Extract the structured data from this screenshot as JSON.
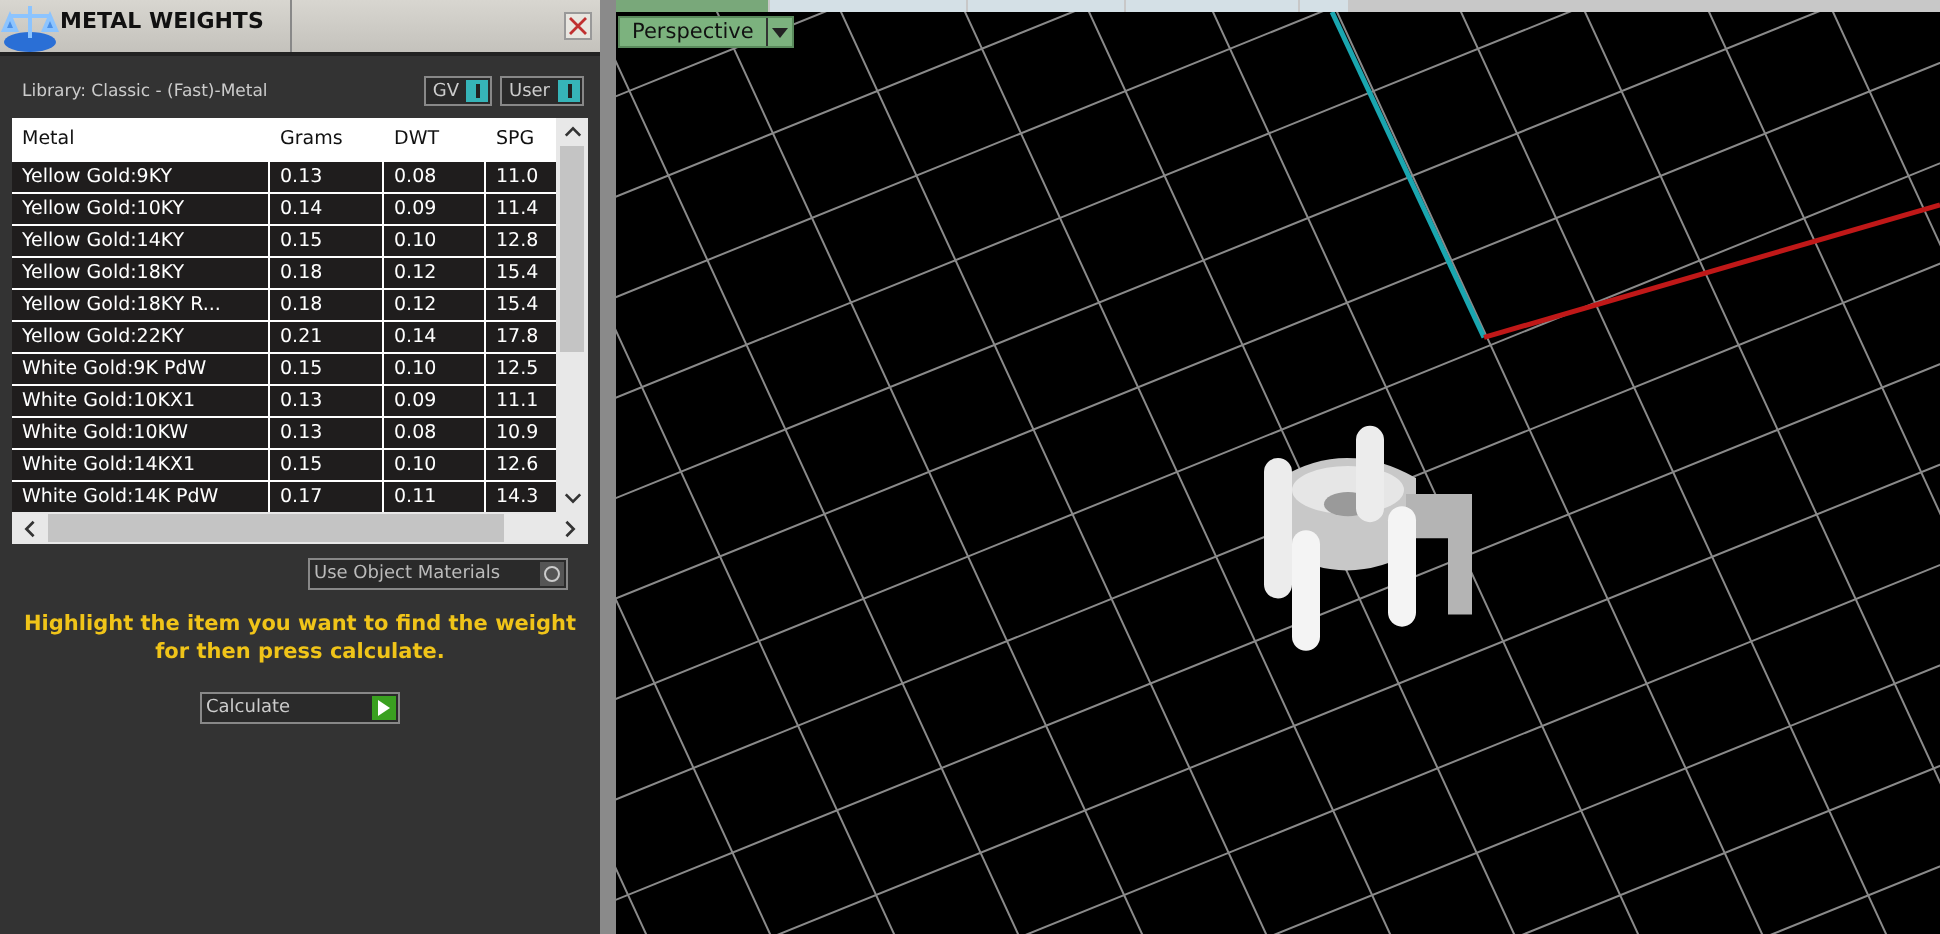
{
  "panel": {
    "title": "METAL WEIGHTS",
    "library": "Library: Classic - (Fast)-Metal",
    "toggles": [
      {
        "label": "GV",
        "on": true
      },
      {
        "label": "User",
        "on": true
      }
    ],
    "table": {
      "columns": [
        "Metal",
        "Grams",
        "DWT",
        "SPG"
      ],
      "rows": [
        [
          "Yellow Gold:9KY",
          "0.13",
          "0.08",
          "11.0"
        ],
        [
          "Yellow Gold:10KY",
          "0.14",
          "0.09",
          "11.4"
        ],
        [
          "Yellow Gold:14KY",
          "0.15",
          "0.10",
          "12.8"
        ],
        [
          "Yellow Gold:18KY",
          "0.18",
          "0.12",
          "15.4"
        ],
        [
          "Yellow Gold:18KY R...",
          "0.18",
          "0.12",
          "15.4"
        ],
        [
          "Yellow Gold:22KY",
          "0.21",
          "0.14",
          "17.8"
        ],
        [
          "White Gold:9K PdW",
          "0.15",
          "0.10",
          "12.5"
        ],
        [
          "White Gold:10KX1",
          "0.13",
          "0.09",
          "11.1"
        ],
        [
          "White Gold:10KW",
          "0.13",
          "0.08",
          "10.9"
        ],
        [
          "White Gold:14KX1",
          "0.15",
          "0.10",
          "12.6"
        ],
        [
          "White Gold:14K PdW",
          "0.17",
          "0.11",
          "14.3"
        ]
      ]
    },
    "use_object_materials": {
      "label": "Use Object Materials",
      "on": false
    },
    "hint": "Highlight the item you want to find the weight for then press calculate.",
    "calculate_button": "Calculate"
  },
  "viewport": {
    "tabs": [
      {
        "selected": true
      },
      {
        "selected": false
      },
      {
        "selected": false
      },
      {
        "selected": false
      },
      {
        "selected": false
      }
    ],
    "view_menu": "Perspective"
  }
}
